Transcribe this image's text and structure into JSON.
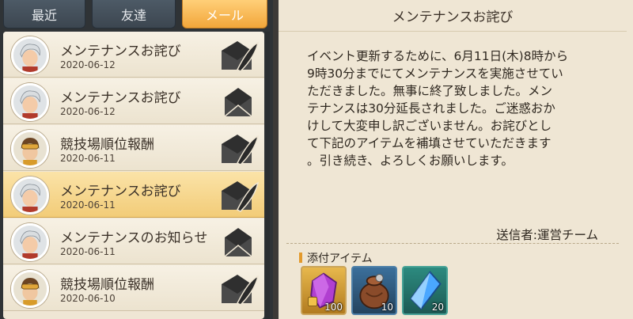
{
  "tabs": [
    {
      "label": "最近"
    },
    {
      "label": "友達"
    },
    {
      "label": "メール",
      "active": true
    }
  ],
  "mail_list": [
    {
      "title": "メンテナンスお詫び",
      "date": "2020-06-12",
      "avatar": "white-haired-character",
      "icon": "envelope-feather-icon"
    },
    {
      "title": "メンテナンスお詫び",
      "date": "2020-06-12",
      "avatar": "white-haired-character",
      "icon": "envelope-icon"
    },
    {
      "title": "競技場順位報酬",
      "date": "2020-06-11",
      "avatar": "goggles-character",
      "icon": "envelope-feather-icon"
    },
    {
      "title": "メンテナンスお詫び",
      "date": "2020-06-11",
      "avatar": "white-haired-character",
      "icon": "envelope-feather-icon",
      "selected": true
    },
    {
      "title": "メンテナンスのお知らせ",
      "date": "2020-06-11",
      "avatar": "white-haired-character",
      "icon": "envelope-icon"
    },
    {
      "title": "競技場順位報酬",
      "date": "2020-06-10",
      "avatar": "goggles-character",
      "icon": "envelope-feather-icon"
    }
  ],
  "detail": {
    "title": "メンテナンスお詫び",
    "body": "イベント更新するために、6月11日(木)8時から\n9時30分までにてメンテナンスを実施させてい\nただきました。無事に終了致しました。メン\nテナンスは30分延長されました。ご迷惑おか\nけして大変申し訳ございません。お詫びとし\nて下記のアイテムを補填させていただきます\n。引き続き、よろしくお願いします。",
    "sender": "送信者:運営チーム",
    "attachments_label": "添付アイテム",
    "attachments": [
      {
        "name": "purple-gem-icon",
        "quantity": "100"
      },
      {
        "name": "treasure-bag-icon",
        "quantity": "10"
      },
      {
        "name": "blue-crystal-icon",
        "quantity": "20"
      }
    ]
  },
  "colors": {
    "active_tab": "#f2a63a",
    "selected_row": "#f2cc78",
    "panel_bg": "#efe6d4"
  }
}
